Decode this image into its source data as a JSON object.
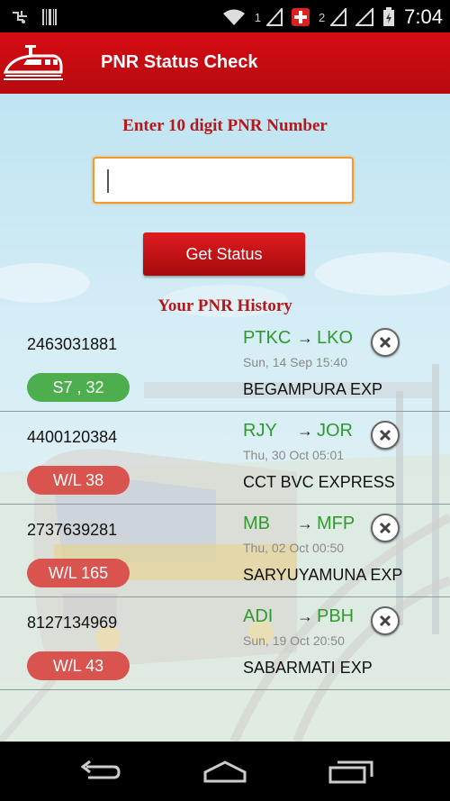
{
  "status_bar": {
    "time": "7:04",
    "sim1": "1",
    "sim2": "2",
    "icons": [
      "usb-debug-icon",
      "barcode-icon",
      "wifi-icon",
      "sim1-signal-icon",
      "emergency-icon",
      "sim2-signal-icon",
      "signal-icon",
      "battery-charging-icon"
    ]
  },
  "app_bar": {
    "title": "PNR Status Check",
    "logo_icon": "train-logo-icon"
  },
  "form": {
    "label": "Enter 10 digit PNR Number",
    "input_value": "",
    "button_label": "Get Status"
  },
  "history": {
    "label": "Your PNR History",
    "items": [
      {
        "pnr": "2463031881",
        "status": "S7 , 32",
        "from": "PTKC",
        "to": "LKO",
        "date": "Sun, 14 Sep 15:40",
        "train": "BEGAMPURA EXP",
        "status_color": "#4cae4c"
      },
      {
        "pnr": "4400120384",
        "status": "W/L 38",
        "from": "RJY",
        "to": "JOR",
        "date": "Thu, 30 Oct 05:01",
        "train": "CCT BVC EXPRESS",
        "status_color": "#d9534f"
      },
      {
        "pnr": "2737639281",
        "status": "W/L 165",
        "from": "MB",
        "to": "MFP",
        "date": "Thu, 02 Oct 00:50",
        "train": "SARYUYAMUNA EXP",
        "status_color": "#d9534f"
      },
      {
        "pnr": "8127134969",
        "status": "W/L 43",
        "from": "ADI",
        "to": "PBH",
        "date": "Sun, 19 Oct 20:50",
        "train": "SABARMATI EXP",
        "status_color": "#d9534f"
      }
    ]
  },
  "nav_bar": {
    "icons": [
      "back-icon",
      "home-icon",
      "recents-icon"
    ]
  },
  "colors": {
    "app_bar": "#c90b10",
    "accent_text": "#b5171a",
    "station_green": "#2f9b2f",
    "confirmed": "#4cae4c",
    "waitlist": "#d9534f"
  }
}
